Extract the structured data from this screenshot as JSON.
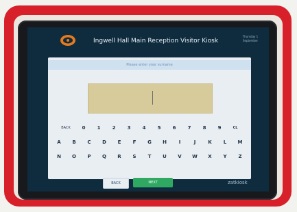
{
  "header": {
    "title": "Ingwell Hall Main Reception Visitor Kiosk",
    "info_line1": "Thursday 1",
    "info_line2": "September"
  },
  "panel": {
    "prompt": "Please enter your surname"
  },
  "keyboard": {
    "row1": [
      "BACK",
      "0",
      "1",
      "2",
      "3",
      "4",
      "5",
      "6",
      "7",
      "8",
      "9",
      "CL"
    ],
    "row2": [
      "A",
      "B",
      "C",
      "D",
      "E",
      "F",
      "G",
      "H",
      "I",
      "J",
      "K",
      "L",
      "M"
    ],
    "row3": [
      "N",
      "O",
      "P",
      "Q",
      "R",
      "S",
      "T",
      "U",
      "V",
      "W",
      "X",
      "Y",
      "Z"
    ]
  },
  "footer": {
    "back_label": "BACK",
    "next_label": "NEXT",
    "brand": "zatkiosk"
  },
  "colors": {
    "frame": "#d8202b",
    "screen_bg": "#0f2c3f",
    "input_bg": "#d8cb9b",
    "next_button": "#2fa862"
  }
}
